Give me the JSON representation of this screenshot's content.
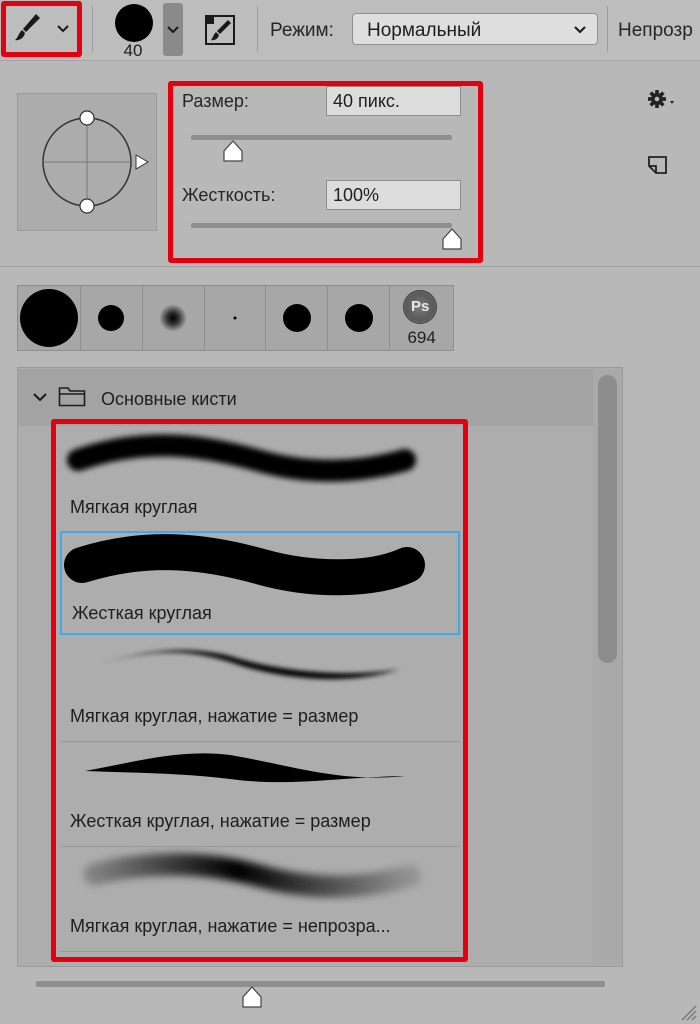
{
  "toolbar": {
    "brush_tool_icon": "brush-icon",
    "brush_size_value": "40",
    "mode_label": "Режим:",
    "mode_value": "Нормальный",
    "opacity_label": "Непрозр"
  },
  "brush_settings": {
    "size_label": "Размер:",
    "size_value": "40 пикс.",
    "size_slider_percent": 16,
    "hardness_label": "Жесткость:",
    "hardness_value": "100%",
    "hardness_slider_percent": 100,
    "settings_icon": "gear-icon",
    "new_preset_icon": "new-preset-icon"
  },
  "presets": {
    "count_label": "694",
    "ps_badge": "Ps"
  },
  "brush_list": {
    "group_name": "Основные кисти",
    "items": [
      {
        "name": "Мягкая круглая"
      },
      {
        "name": "Жесткая круглая",
        "selected": true
      },
      {
        "name": "Мягкая круглая, нажатие = размер"
      },
      {
        "name": "Жесткая круглая, нажатие = размер"
      },
      {
        "name": "Мягкая круглая, нажатие = непрозра..."
      }
    ]
  },
  "preview_slider_percent": 38,
  "colors": {
    "highlight": "#e3000f",
    "selection": "#3fa8e6",
    "panel": "#b8b8b8"
  }
}
